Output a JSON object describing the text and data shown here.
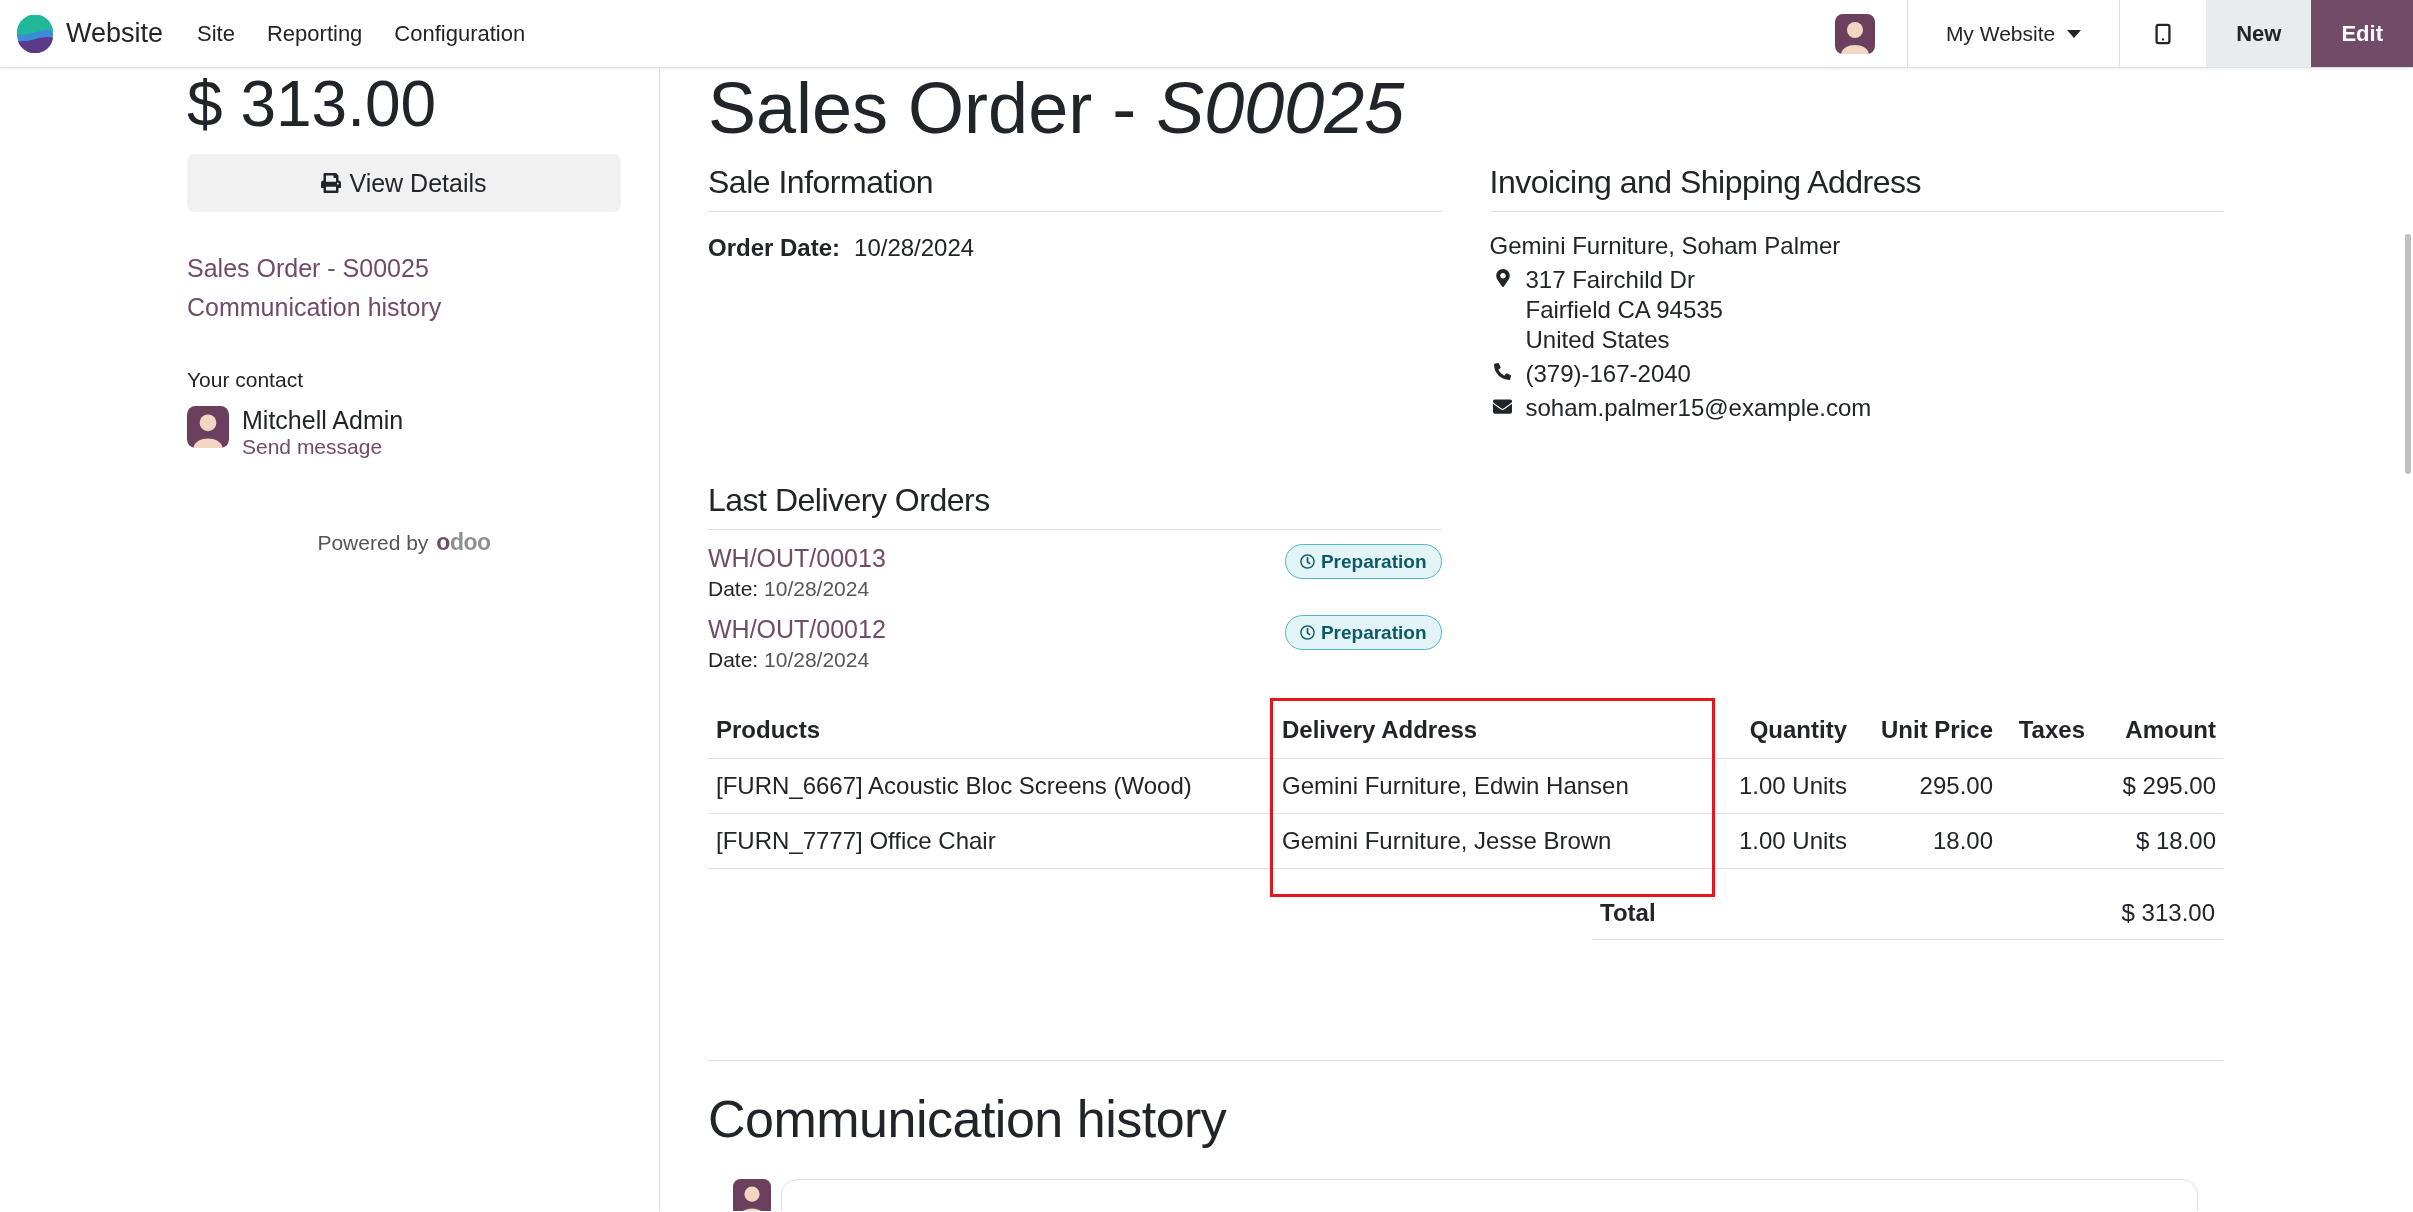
{
  "navbar": {
    "brand": "Website",
    "menu": [
      {
        "label": "Site"
      },
      {
        "label": "Reporting"
      },
      {
        "label": "Configuration"
      }
    ],
    "site_selector": "My Website",
    "buttons": [
      {
        "label": "New",
        "kind": "secondary"
      },
      {
        "label": "Edit",
        "kind": "primary"
      }
    ]
  },
  "sidebar": {
    "amount": "$ 313.00",
    "view_button": "View Details",
    "links": [
      "Sales Order - S00025",
      "Communication history"
    ],
    "contact_heading": "Your contact",
    "contact_name": "Mitchell Admin",
    "contact_action": "Send message",
    "powered_by": "Powered by",
    "powered_logo": "odoo"
  },
  "title": "Sales Order - *S00025*",
  "sale_information": {
    "heading": "Sale Information",
    "fields": [
      {
        "label": "Order Date:",
        "value": "10/28/2024"
      }
    ]
  },
  "address": {
    "heading": "Invoicing and Shipping Address",
    "name": "Gemini Furniture, Soham Palmer",
    "street": [
      "317 Fairchild Dr",
      "Fairfield CA 94535",
      "United States"
    ],
    "phone": "(379)-167-2040",
    "email": "soham.palmer15@example.com"
  },
  "deliveries": {
    "heading": "Last Delivery Orders",
    "items": [
      {
        "reference": "WH/OUT/00013",
        "date_label": "Date:",
        "date": "10/28/2024",
        "status": "Preparation"
      },
      {
        "reference": "WH/OUT/00012",
        "date_label": "Date:",
        "date": "10/28/2024",
        "status": "Preparation"
      }
    ]
  },
  "order_lines": {
    "columns": [
      {
        "label": "Products",
        "highlighted": false
      },
      {
        "label": "Delivery Address",
        "highlighted": true
      },
      {
        "label": "Quantity",
        "highlighted": false
      },
      {
        "label": "Unit Price",
        "highlighted": false
      },
      {
        "label": "Taxes",
        "highlighted": false
      },
      {
        "label": "Amount",
        "highlighted": false
      }
    ],
    "rows": [
      {
        "product": "[FURN_6667] Acoustic Bloc Screens (Wood)",
        "delivery_address": "Gemini Furniture, Edwin Hansen",
        "quantity": "1.00 Units",
        "unit_price": "295.00",
        "amount": "$ 295.00"
      },
      {
        "product": "[FURN_7777] Office Chair",
        "delivery_address": "Gemini Furniture, Jesse Brown",
        "quantity": "1.00 Units",
        "unit_price": "18.00",
        "amount": "$ 18.00"
      }
    ],
    "total": {
      "label": "Total",
      "value": "$ 313.00"
    }
  },
  "communication": {
    "heading": "Communication history"
  }
}
